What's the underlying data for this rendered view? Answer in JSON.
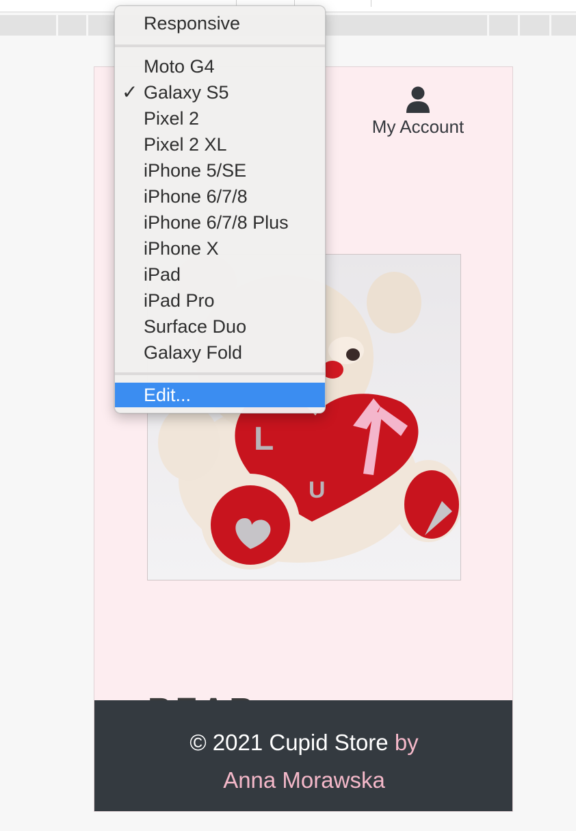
{
  "menu": {
    "responsive": "Responsive",
    "devices": [
      {
        "label": "Moto G4",
        "check": ""
      },
      {
        "label": "Galaxy S5",
        "check": "✓"
      },
      {
        "label": "Pixel 2",
        "check": ""
      },
      {
        "label": "Pixel 2 XL",
        "check": ""
      },
      {
        "label": "iPhone 5/SE",
        "check": ""
      },
      {
        "label": "iPhone 6/7/8",
        "check": ""
      },
      {
        "label": "iPhone 6/7/8 Plus",
        "check": ""
      },
      {
        "label": "iPhone X",
        "check": ""
      },
      {
        "label": "iPad",
        "check": ""
      },
      {
        "label": "iPad Pro",
        "check": ""
      },
      {
        "label": "Surface Duo",
        "check": ""
      },
      {
        "label": "Galaxy Fold",
        "check": ""
      }
    ],
    "edit": "Edit..."
  },
  "page": {
    "account_label": "My Account",
    "account_icon": "user-icon",
    "product_image": "teddy-bear-with-heart-image",
    "heading_fragment": "BEAR"
  },
  "footer": {
    "copyright": "© 2021 Cupid Store",
    "by": "by",
    "author": "Anna Morawska"
  },
  "colors": {
    "page_bg": "#fdedf0",
    "footer_bg": "#343a40",
    "footer_link": "#f4b8c9",
    "menu_highlight": "#3b8df1"
  }
}
